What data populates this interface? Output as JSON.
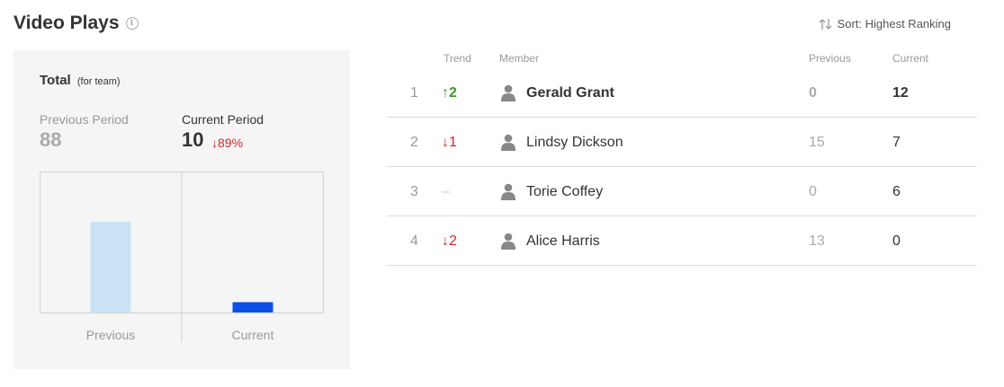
{
  "header": {
    "title": "Video Plays",
    "info_icon": "info-icon",
    "sort_icon": "sort-arrows-icon",
    "sort_label": "Sort: Highest Ranking"
  },
  "summary": {
    "total_label": "Total",
    "total_sub": "(for team)",
    "previous_label": "Previous Period",
    "previous_value": "88",
    "current_label": "Current Period",
    "current_value": "10",
    "change": "↓89%"
  },
  "chart_data": {
    "type": "bar",
    "categories": [
      "Previous",
      "Current"
    ],
    "values": [
      88,
      10
    ],
    "ylim": [
      0,
      88
    ],
    "colors": [
      "#c9e3f5",
      "#0b4fe8"
    ],
    "grid": false
  },
  "table": {
    "columns": {
      "trend": "Trend",
      "member": "Member",
      "previous": "Previous",
      "current": "Current"
    },
    "rows": [
      {
        "rank": "1",
        "trend": "↑2",
        "trend_dir": "up",
        "member": "Gerald Grant",
        "previous": "0",
        "current": "12",
        "highlight": true
      },
      {
        "rank": "2",
        "trend": "↓1",
        "trend_dir": "down",
        "member": "Lindsy Dickson",
        "previous": "15",
        "current": "7",
        "highlight": false
      },
      {
        "rank": "3",
        "trend": "–",
        "trend_dir": "none",
        "member": "Torie Coffey",
        "previous": "0",
        "current": "6",
        "highlight": false
      },
      {
        "rank": "4",
        "trend": "↓2",
        "trend_dir": "down",
        "member": "Alice Harris",
        "previous": "13",
        "current": "0",
        "highlight": false
      }
    ],
    "avatar_icon": "user-avatar-icon"
  },
  "colors": {
    "up": "#3c9a2a",
    "down": "#d9242a",
    "card_bg": "#f5f5f5"
  }
}
